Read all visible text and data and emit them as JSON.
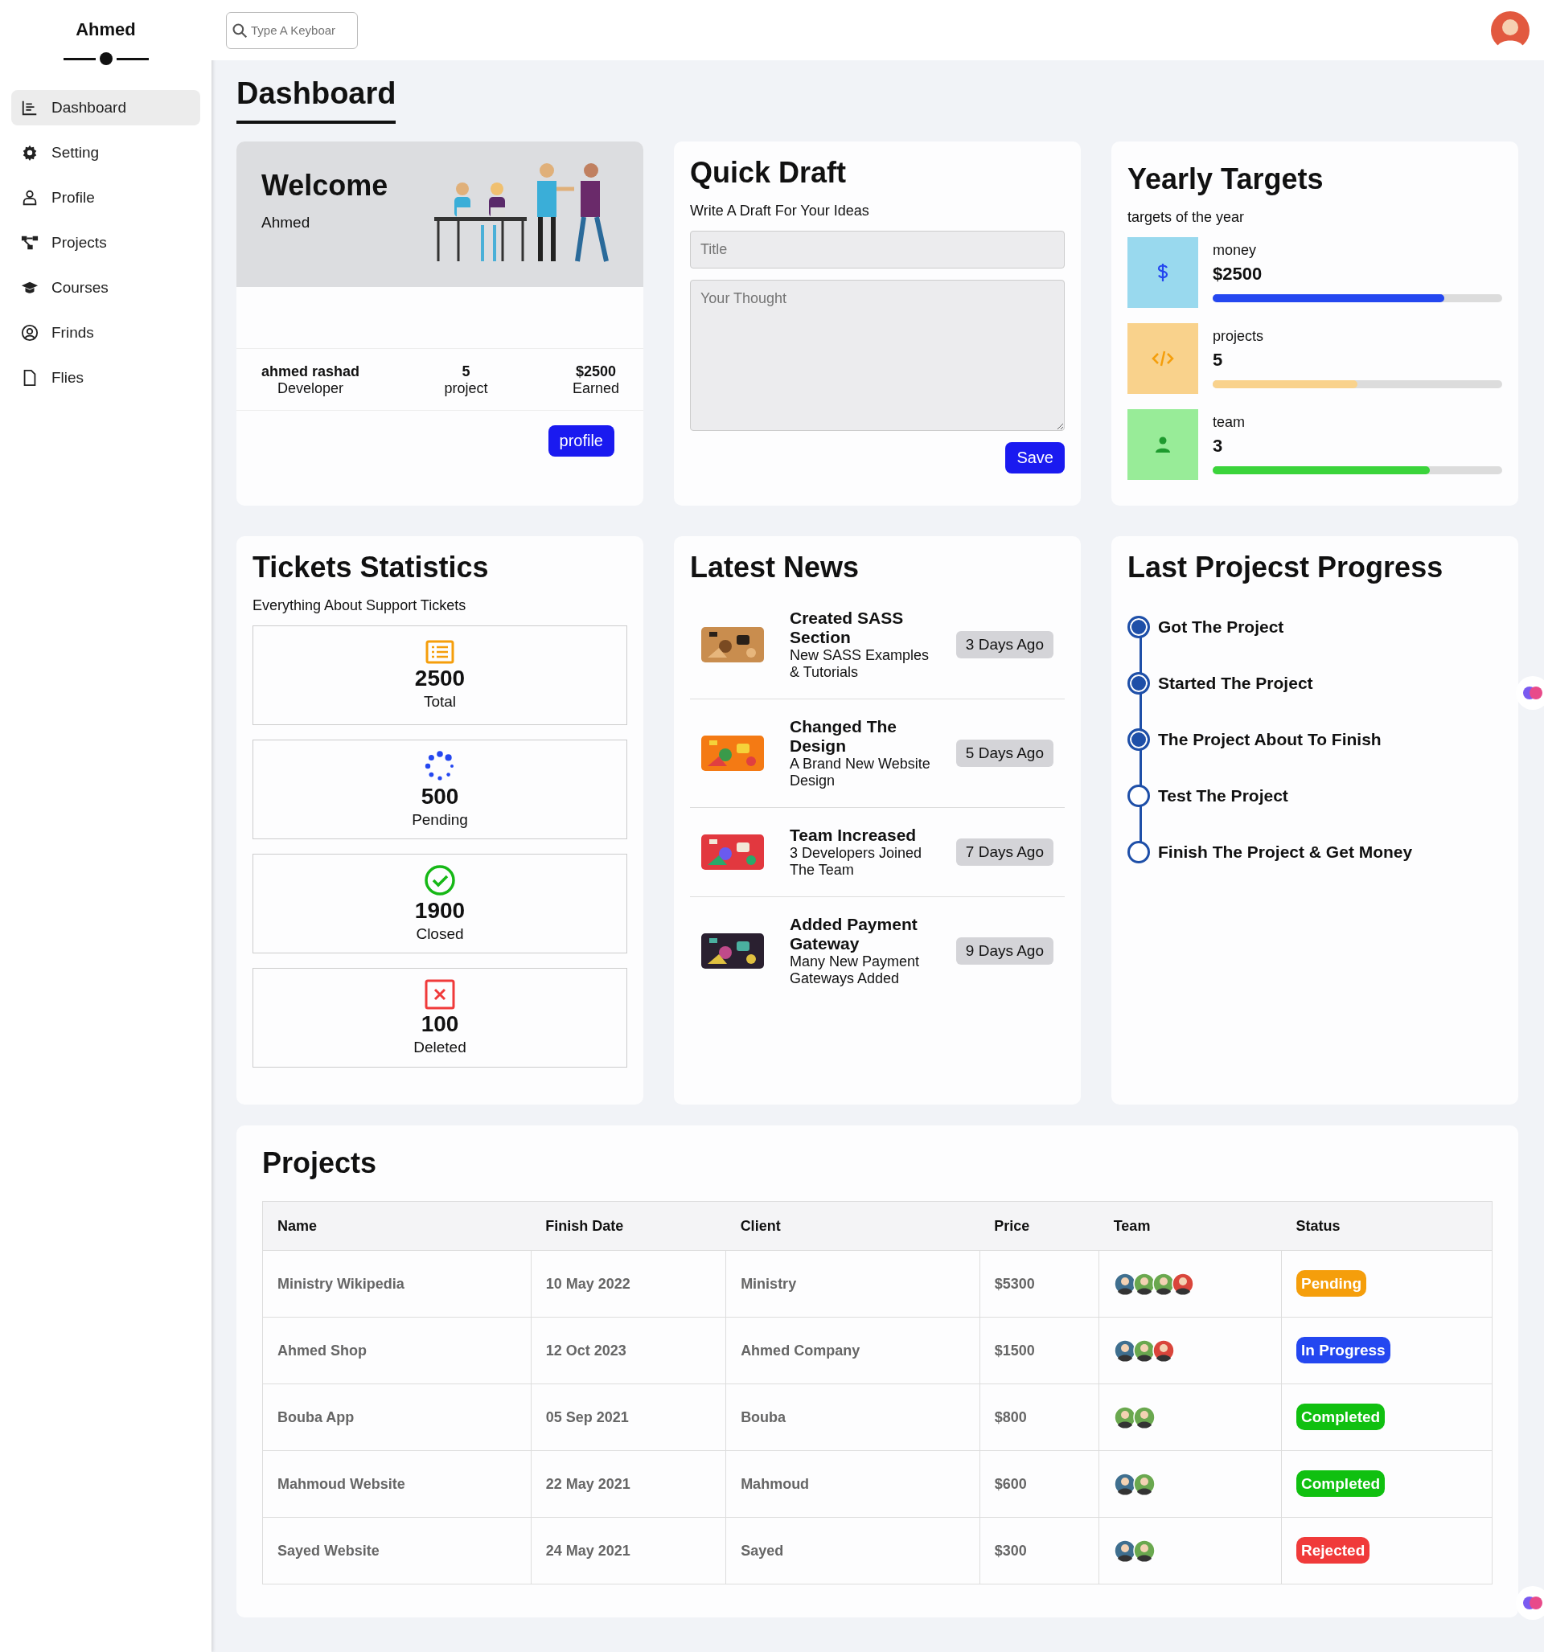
{
  "sidebar": {
    "brand": "Ahmed",
    "items": [
      {
        "label": "Dashboard",
        "kind": "chart",
        "selected": true
      },
      {
        "label": "Setting",
        "kind": "gear",
        "selected": false
      },
      {
        "label": "Profile",
        "kind": "user",
        "selected": false
      },
      {
        "label": "Projects",
        "kind": "nodes",
        "selected": false
      },
      {
        "label": "Courses",
        "kind": "cap",
        "selected": false
      },
      {
        "label": "Frinds",
        "kind": "usercircle",
        "selected": false
      },
      {
        "label": "Flies",
        "kind": "file",
        "selected": false
      }
    ]
  },
  "search": {
    "placeholder": "Type A Keyboar"
  },
  "page_title": "Dashboard",
  "welcome": {
    "title": "Welcome",
    "name": "Ahmed",
    "stats": [
      {
        "value": "ahmed rashad",
        "label": "Developer"
      },
      {
        "value": "5",
        "label": "project"
      },
      {
        "value": "$2500",
        "label": "Earned"
      }
    ],
    "button": "profile"
  },
  "quick_draft": {
    "title": "Quick Draft",
    "subtitle": "Write A Draft For Your Ideas",
    "title_placeholder": "Title",
    "body_placeholder": "Your Thought",
    "button": "Save"
  },
  "yearly_targets": {
    "title": "Yearly Targets",
    "subtitle": "targets of the year",
    "items": [
      {
        "kind": "money",
        "label": "money",
        "value": "$2500",
        "level": 0.8,
        "color": "#2447f0"
      },
      {
        "kind": "code",
        "label": "projects",
        "value": "5",
        "level": 0.5,
        "color": "#f9d28c"
      },
      {
        "kind": "person",
        "label": "team",
        "value": "3",
        "level": 0.75,
        "color": "#3bd43b"
      }
    ]
  },
  "tickets": {
    "title": "Tickets Statistics",
    "subtitle": "Everything About Support Tickets",
    "items": [
      {
        "kind": "list",
        "value": "2500",
        "label": "Total"
      },
      {
        "kind": "spinner",
        "value": "500",
        "label": "Pending"
      },
      {
        "kind": "check",
        "value": "1900",
        "label": "Closed"
      },
      {
        "kind": "cross",
        "value": "100",
        "label": "Deleted"
      }
    ]
  },
  "latest_news": {
    "title": "Latest News",
    "items": [
      {
        "kind": "picture",
        "title": "Created SASS Section",
        "text": "New SASS Examples & Tutorials",
        "time": "3 Days Ago"
      },
      {
        "kind": "picture",
        "title": "Changed The Design",
        "text": "A Brand New Website Design",
        "time": "5 Days Ago"
      },
      {
        "kind": "picture",
        "title": "Team Increased",
        "text": "3 Developers Joined The Team",
        "time": "7 Days Ago"
      },
      {
        "kind": "picture",
        "title": "Added Payment Gateway",
        "text": "Many New Payment Gateways Added",
        "time": "9 Days Ago"
      }
    ]
  },
  "project_progress": {
    "title": "Last Projecst Progress",
    "steps": [
      {
        "label": "Got The Project",
        "done": true
      },
      {
        "label": "Started The Project",
        "done": true
      },
      {
        "label": "The Project About To Finish",
        "done": true
      },
      {
        "label": "Test The Project",
        "done": false
      },
      {
        "label": "Finish The Project & Get Money",
        "done": false
      }
    ]
  },
  "projects": {
    "title": "Projects",
    "columns": [
      "Name",
      "Finish Date",
      "Client",
      "Price",
      "Team",
      "Status"
    ],
    "rows": [
      {
        "name": "Ministry Wikipedia",
        "date": "10 May 2022",
        "client": "Ministry",
        "price": "$5300",
        "team": [
          {
            "color": "#3f6f8f"
          },
          {
            "color": "#6aa84f"
          },
          {
            "color": "#6aa84f"
          },
          {
            "color": "#d9453b"
          }
        ],
        "status": {
          "kind": "pending",
          "label": "Pending"
        }
      },
      {
        "name": "Ahmed Shop",
        "date": "12 Oct 2023",
        "client": "Ahmed Company",
        "price": "$1500",
        "team": [
          {
            "color": "#3f6f8f"
          },
          {
            "color": "#6aa84f"
          },
          {
            "color": "#d9453b"
          }
        ],
        "status": {
          "kind": "in_progress",
          "label": "In Progress"
        }
      },
      {
        "name": "Bouba App",
        "date": "05 Sep 2021",
        "client": "Bouba",
        "price": "$800",
        "team": [
          {
            "color": "#6aa84f"
          },
          {
            "color": "#6aa84f"
          }
        ],
        "status": {
          "kind": "completed",
          "label": "Completed"
        }
      },
      {
        "name": "Mahmoud Website",
        "date": "22 May 2021",
        "client": "Mahmoud",
        "price": "$600",
        "team": [
          {
            "color": "#3f6f8f"
          },
          {
            "color": "#6aa84f"
          }
        ],
        "status": {
          "kind": "completed",
          "label": "Completed"
        }
      },
      {
        "name": "Sayed Website",
        "date": "24 May 2021",
        "client": "Sayed",
        "price": "$300",
        "team": [
          {
            "color": "#3f6f8f"
          },
          {
            "color": "#6aa84f"
          }
        ],
        "status": {
          "kind": "rejected",
          "label": "Rejected"
        }
      }
    ]
  }
}
